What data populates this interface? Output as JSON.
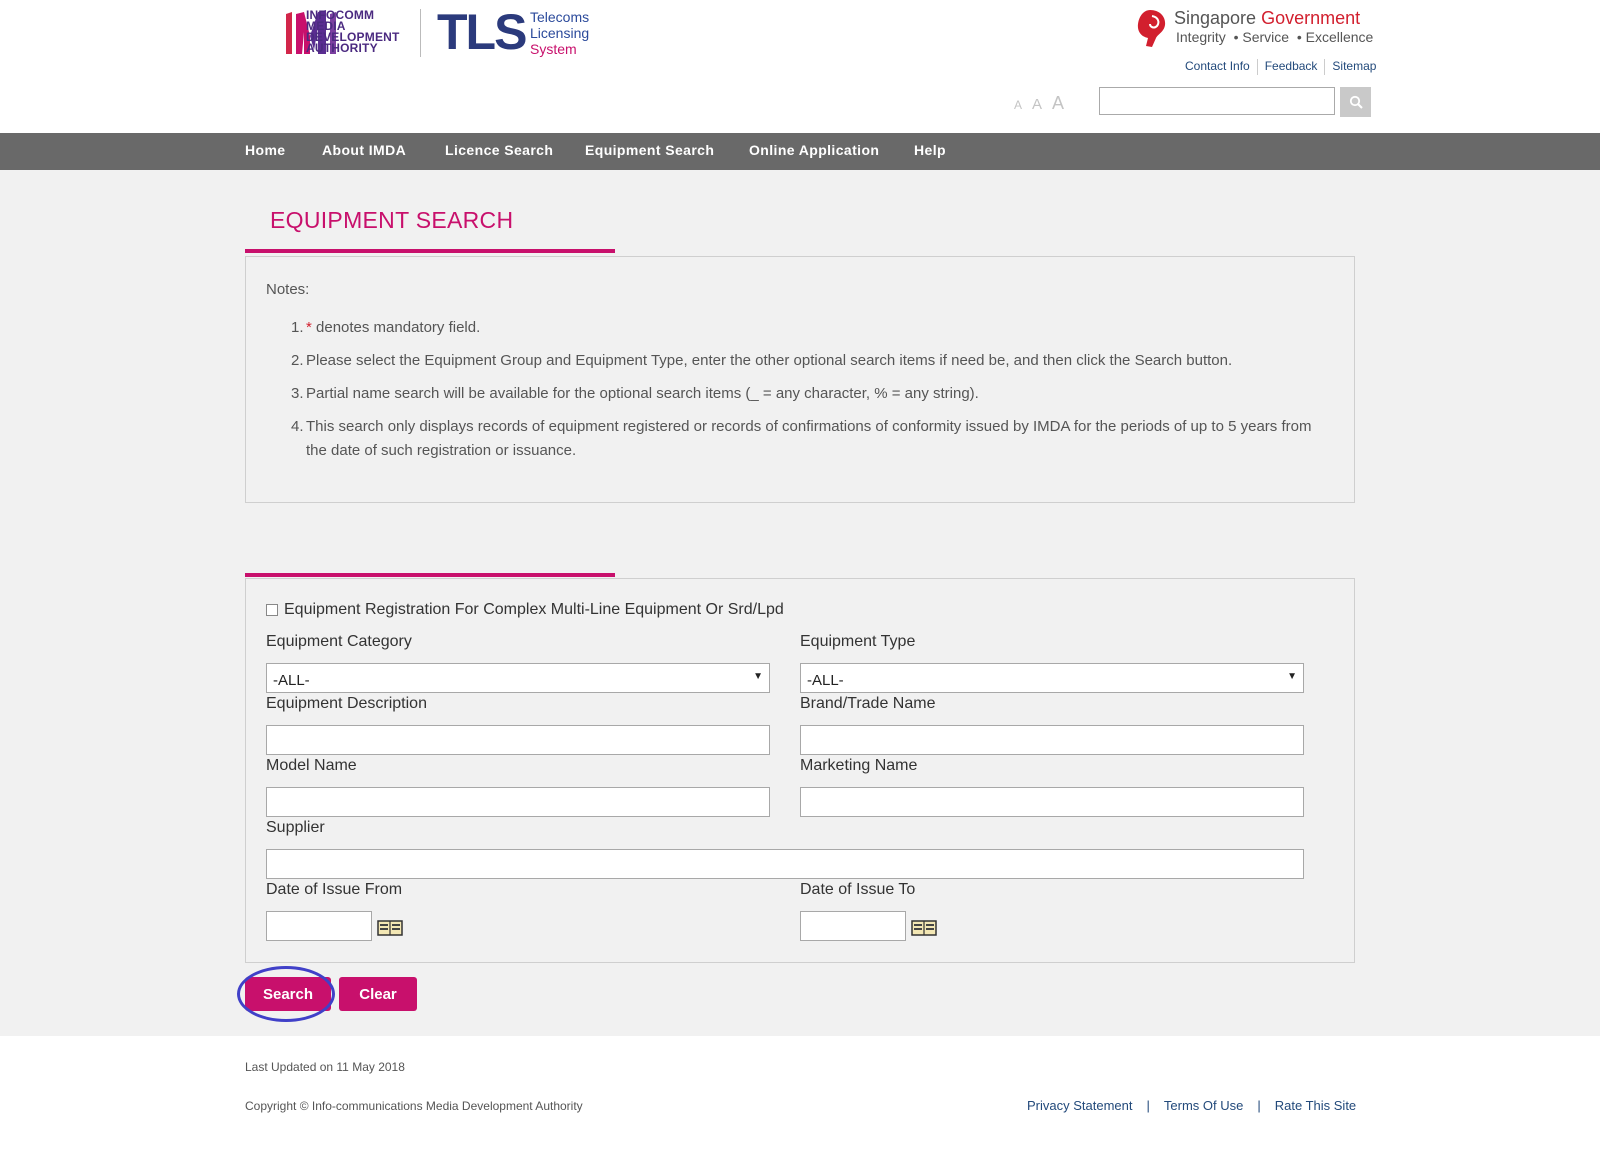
{
  "header": {
    "imda_lines": [
      "INFOCOMM",
      "MEDIA",
      "DEVELOPMENT",
      "AUTHORITY"
    ],
    "tls_mark": "TLS",
    "tls_lines": [
      "Telecoms",
      "Licensing",
      "System"
    ],
    "sg_title_a": "Singapore",
    "sg_title_b": "Government",
    "sg_sub": "Integrity  • Service  • Excellence",
    "top_links": [
      "Contact Info",
      "Feedback",
      "Sitemap"
    ],
    "font_sizes": [
      "A",
      "A",
      "A"
    ],
    "search_value": ""
  },
  "nav": [
    "Home",
    "About IMDA",
    "Licence Search",
    "Equipment Search",
    "Online Application",
    "Help"
  ],
  "page_title": "EQUIPMENT SEARCH",
  "notes": {
    "heading": "Notes:",
    "items": [
      {
        "num": "1.",
        "star": "*",
        "text": " denotes mandatory field."
      },
      {
        "num": "2.",
        "text": "Please select the Equipment Group and Equipment Type, enter the other optional search items if need be, and then click the Search button."
      },
      {
        "num": "3.",
        "text": "Partial name search will be available for the optional search items (_ = any character, % = any string)."
      },
      {
        "num": "4.",
        "text": "This search only displays records of equipment registered or records of confirmations of conformity issued by IMDA for the periods of up to 5 years from the date of such registration or issuance."
      }
    ]
  },
  "form": {
    "complex_checkbox_label": "Equipment Registration For Complex Multi-Line Equipment Or Srd/Lpd",
    "complex_checked": false,
    "equipment_category_label": "Equipment Category",
    "equipment_category_value": "-ALL-",
    "equipment_type_label": "Equipment Type",
    "equipment_type_value": "-ALL-",
    "equipment_description_label": "Equipment Description",
    "brand_label": "Brand/Trade Name",
    "model_label": "Model Name",
    "marketing_label": "Marketing Name",
    "supplier_label": "Supplier",
    "date_from_label": "Date of Issue From",
    "date_to_label": "Date of Issue To",
    "search_button": "Search",
    "clear_button": "Clear"
  },
  "footer": {
    "last_updated": "Last Updated on 11 May 2018",
    "copyright": "Copyright © Info-communications Media Development Authority",
    "links": [
      "Privacy Statement",
      "Terms Of Use",
      "Rate This Site"
    ]
  },
  "colors": {
    "accent": "#c8106c",
    "nav_bg": "#696969",
    "main_bg": "#f1f1f1",
    "link": "#234a7b",
    "highlight_circle": "#4040c8"
  }
}
